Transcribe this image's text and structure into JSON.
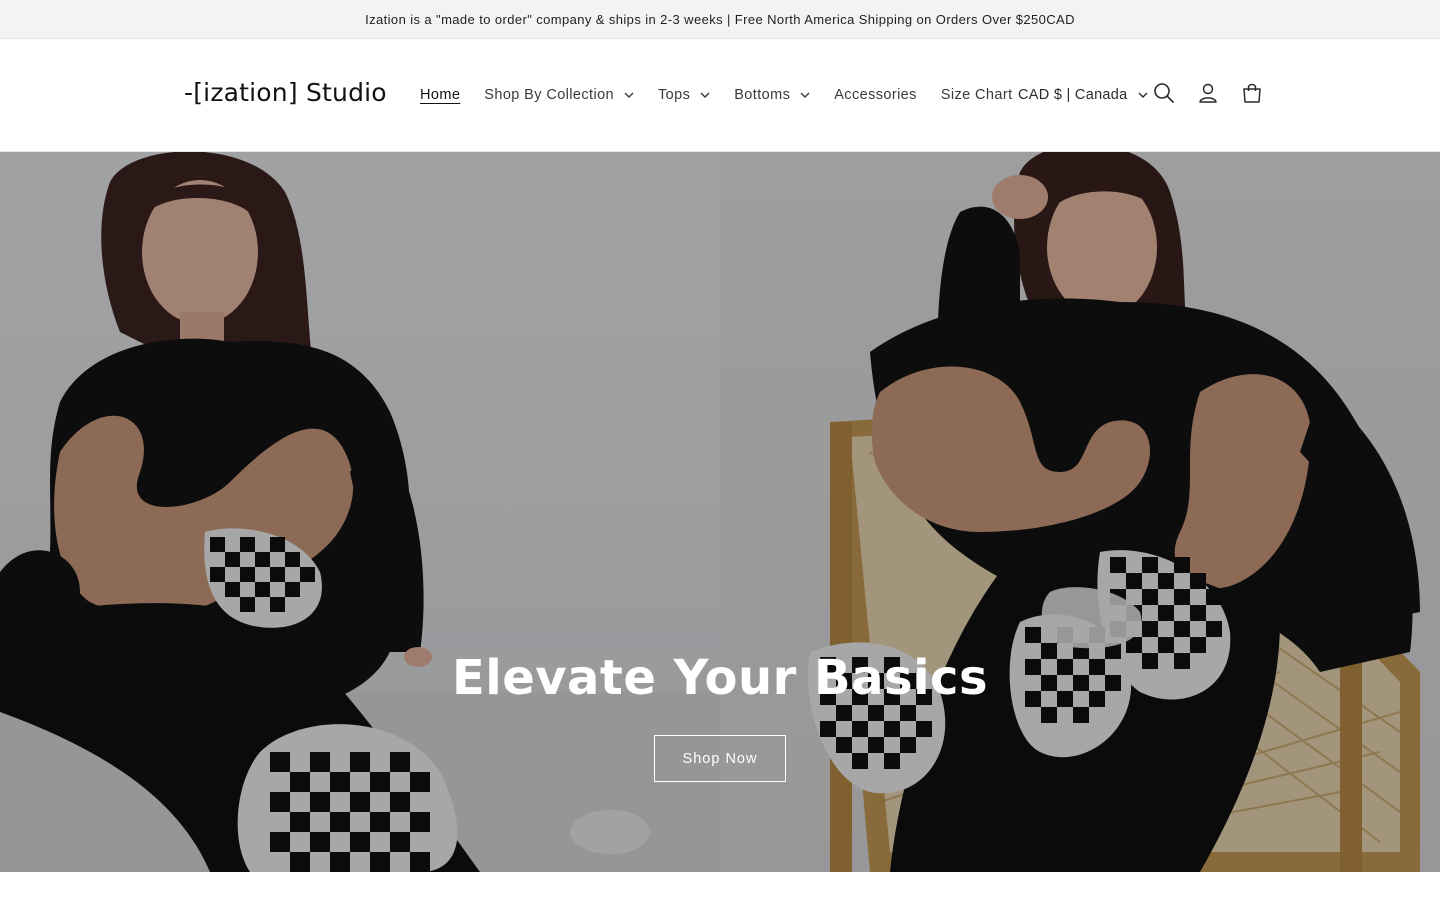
{
  "announcement": {
    "text": "Ization is a \"made to order\" company & ships in 2-3 weeks | Free North America Shipping on Orders Over $250CAD"
  },
  "header": {
    "logo": "-[ization] Studio",
    "nav": [
      {
        "label": "Home",
        "active": true,
        "dropdown": false
      },
      {
        "label": "Shop By Collection",
        "dropdown": true
      },
      {
        "label": "Tops",
        "dropdown": true
      },
      {
        "label": "Bottoms",
        "dropdown": true
      },
      {
        "label": "Accessories",
        "dropdown": false
      },
      {
        "label": "Size Chart",
        "dropdown": false
      }
    ],
    "localization": "CAD $ | Canada",
    "icons": [
      "search-icon",
      "account-icon",
      "cart-icon"
    ]
  },
  "hero": {
    "title": "Elevate Your Basics",
    "button_label": "Shop Now"
  },
  "colors": {
    "text": "#121212",
    "announcement_bg": "#f3f3f3",
    "hero_overlay": "#000000",
    "hero_text": "#ffffff",
    "sweater_black": "#121212",
    "sherpa_tan": "#c9987a"
  }
}
